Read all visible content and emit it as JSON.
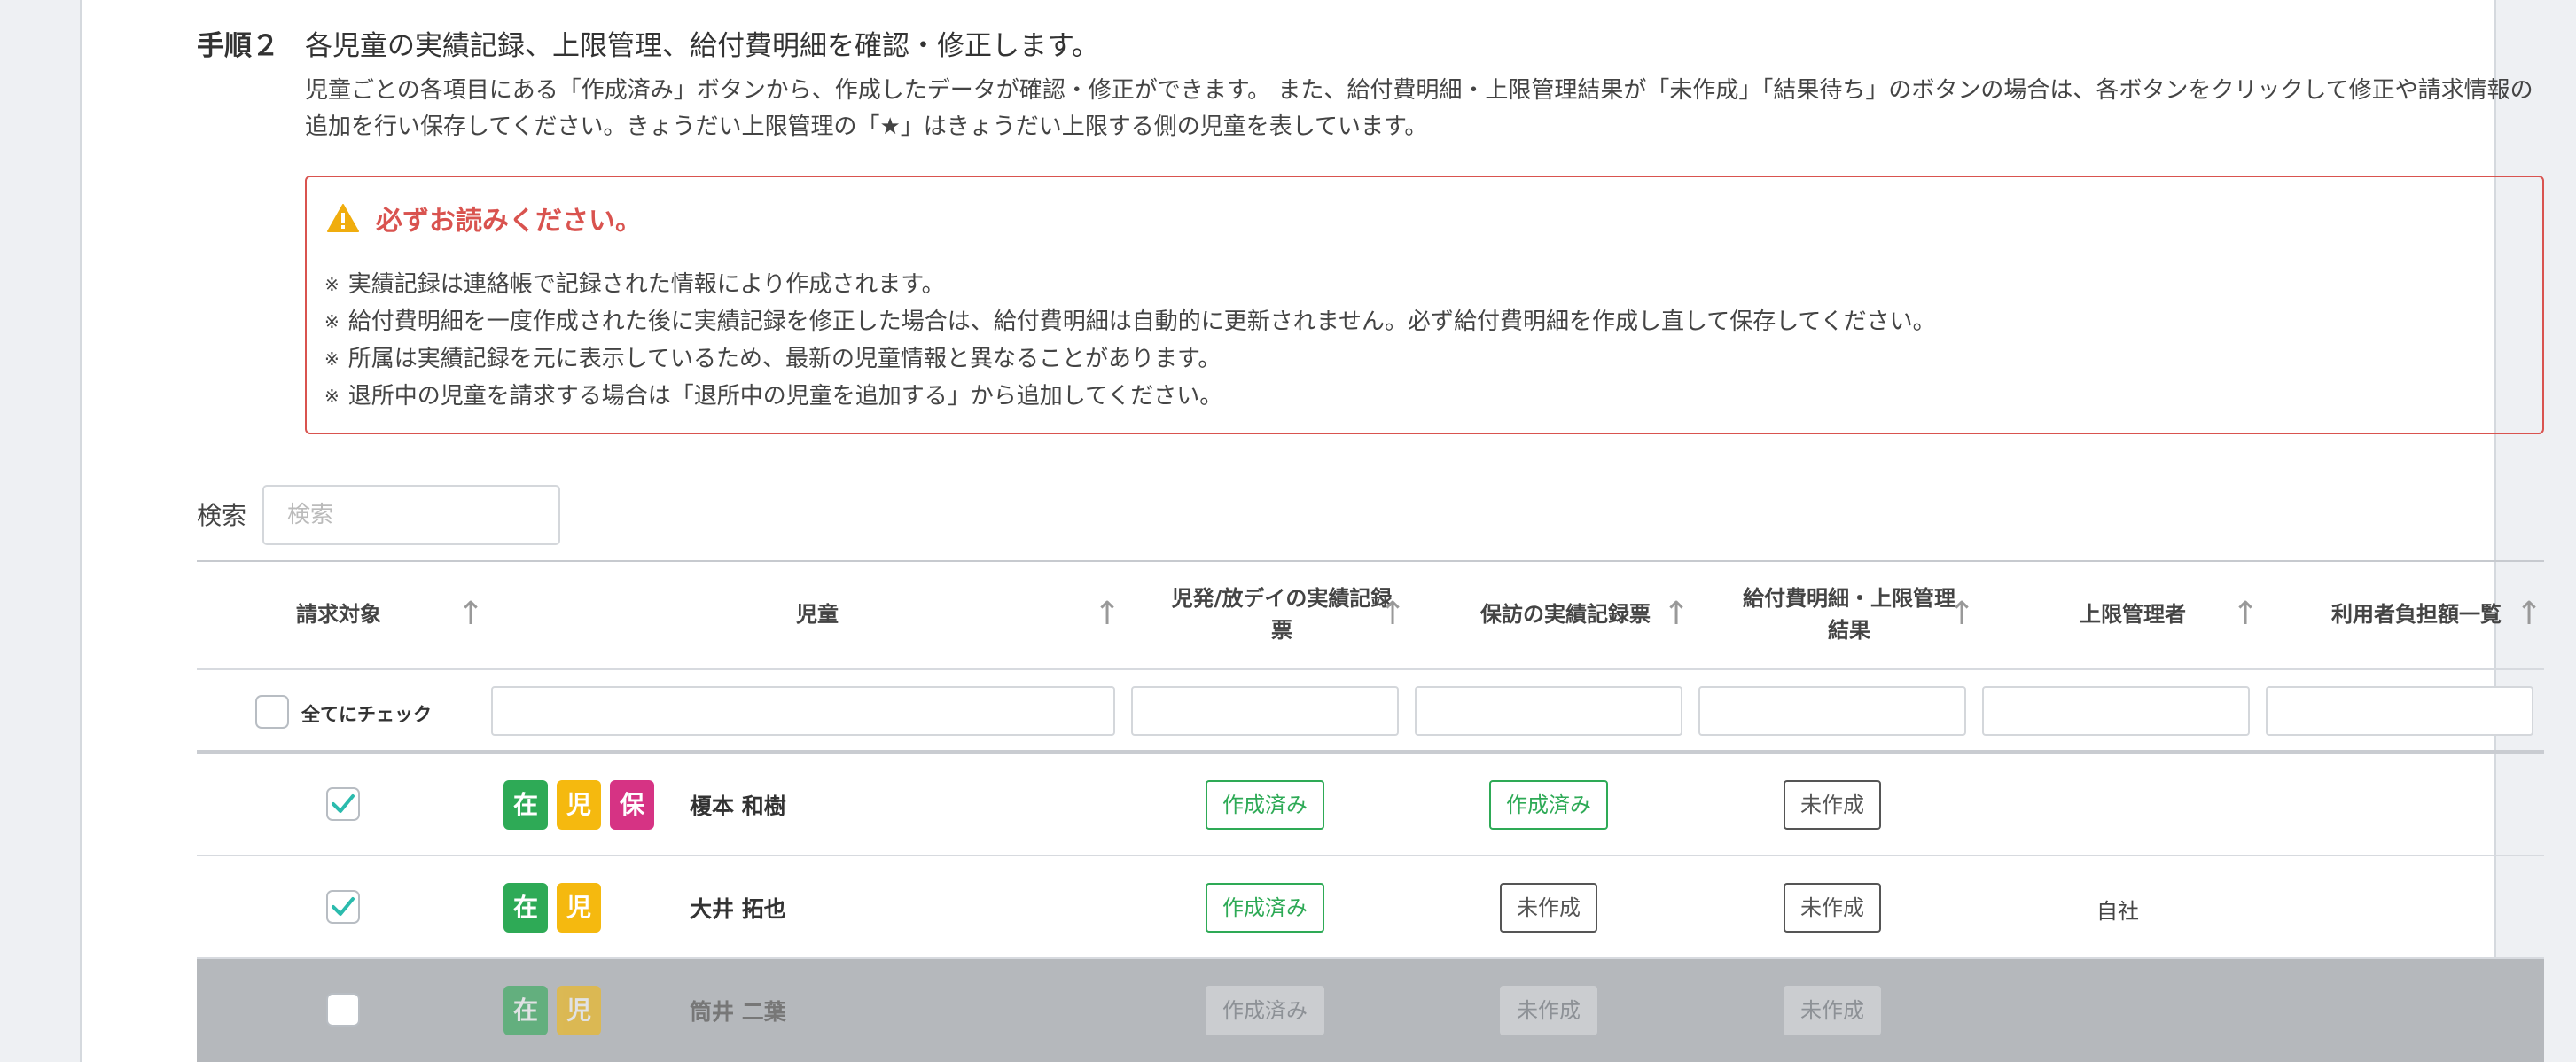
{
  "step": {
    "label": "手順２",
    "title": "各児童の実績記録、上限管理、給付費明細を確認・修正します。",
    "description": "児童ごとの各項目にある「作成済み」ボタンから、作成したデータが確認・修正ができます。 また、給付費明細・上限管理結果が「未作成」「結果待ち」のボタンの場合は、各ボタンをクリックして修正や請求情報の追加を行い保存してください。きょうだい上限管理の「★」はきょうだい上限する側の児童を表しています。"
  },
  "alert": {
    "title": "必ずお読みください。",
    "icon": "warning-icon",
    "notes": [
      "実績記録は連絡帳で記録された情報により作成されます。",
      "給付費明細を一度作成された後に実績記録を修正した場合は、給付費明細は自動的に更新されません。必ず給付費明細を作成し直して保存してください。",
      "所属は実績記録を元に表示しているため、最新の児童情報と異なることがあります。",
      "退所中の児童を請求する場合は「退所中の児童を追加する」から追加してください。"
    ],
    "note_mark": "※"
  },
  "search": {
    "label": "検索",
    "placeholder": "検索"
  },
  "table": {
    "headers": [
      "請求対象",
      "児童",
      "児発/放デイの実績記録票",
      "保訪の実績記録票",
      "給付費明細・上限管理結果",
      "上限管理者",
      "利用者負担額一覧"
    ],
    "sort_arrow": "↑",
    "check_all_label": "全てにチェック",
    "rows": [
      {
        "checked": true,
        "badges": [
          "在",
          "児",
          "保"
        ],
        "name": "榎本 和樹",
        "jippatsu": "作成済み",
        "hohou": "作成済み",
        "kyufu": "未作成",
        "jogen": "",
        "disabled": false
      },
      {
        "checked": true,
        "badges": [
          "在",
          "児"
        ],
        "name": "大井 拓也",
        "jippatsu": "作成済み",
        "hohou": "未作成",
        "kyufu": "未作成",
        "jogen": "自社",
        "disabled": false
      },
      {
        "checked": false,
        "badges": [
          "在",
          "児"
        ],
        "name": "筒井 二葉",
        "jippatsu": "作成済み",
        "hohou": "未作成",
        "kyufu": "未作成",
        "jogen": "",
        "disabled": true
      }
    ]
  },
  "colors": {
    "done": "#2eaa56",
    "alert": "#d9534f",
    "badge_zai": "#2eaa56",
    "badge_ji": "#f5b90f",
    "badge_ho": "#d63384"
  }
}
